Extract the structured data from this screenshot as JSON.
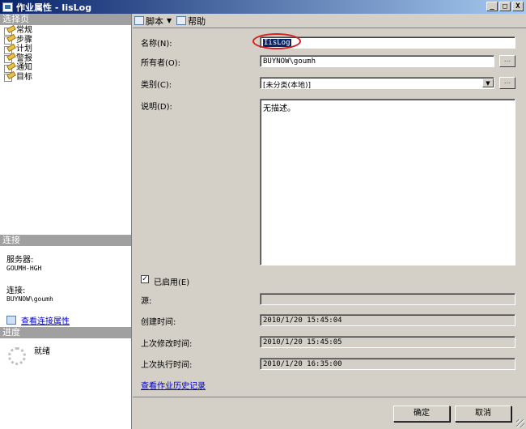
{
  "window": {
    "title": "作业属性 - IisLog",
    "min": "_",
    "max": "□",
    "close": "X"
  },
  "left": {
    "select_page_header": "选择页",
    "pages": [
      "常规",
      "步骤",
      "计划",
      "警报",
      "通知",
      "目标"
    ],
    "connection_header": "连接",
    "server_label": "服务器:",
    "server_value": "GOUMH-HGH",
    "connection_label": "连接:",
    "connection_value": "BUYNOW\\goumh",
    "view_conn_link": "查看连接属性",
    "progress_header": "进度",
    "progress_status": "就绪"
  },
  "toolbar": {
    "script_label": "脚本",
    "help_label": "帮助"
  },
  "form": {
    "name_label": "名称(N):",
    "name_value": "IisLog",
    "owner_label": "所有者(O):",
    "owner_value": "BUYNOW\\goumh",
    "category_label": "类别(C):",
    "category_value": "[未分类(本地)]",
    "desc_label": "说明(D):",
    "desc_value": "无描述。",
    "enabled_label": "已启用(E)",
    "source_label": "源:",
    "source_value": "",
    "created_label": "创建时间:",
    "created_value": "2010/1/20 15:45:04",
    "modified_label": "上次修改时间:",
    "modified_value": "2010/1/20 15:45:05",
    "executed_label": "上次执行时间:",
    "executed_value": "2010/1/20 16:35:00",
    "history_link": "查看作业历史记录",
    "ellipsis": "..."
  },
  "buttons": {
    "ok": "确定",
    "cancel": "取消"
  },
  "colors": {
    "title_start": "#0a246a",
    "title_end": "#a6caf0",
    "highlight": "#d42020",
    "link": "#0000cc"
  }
}
